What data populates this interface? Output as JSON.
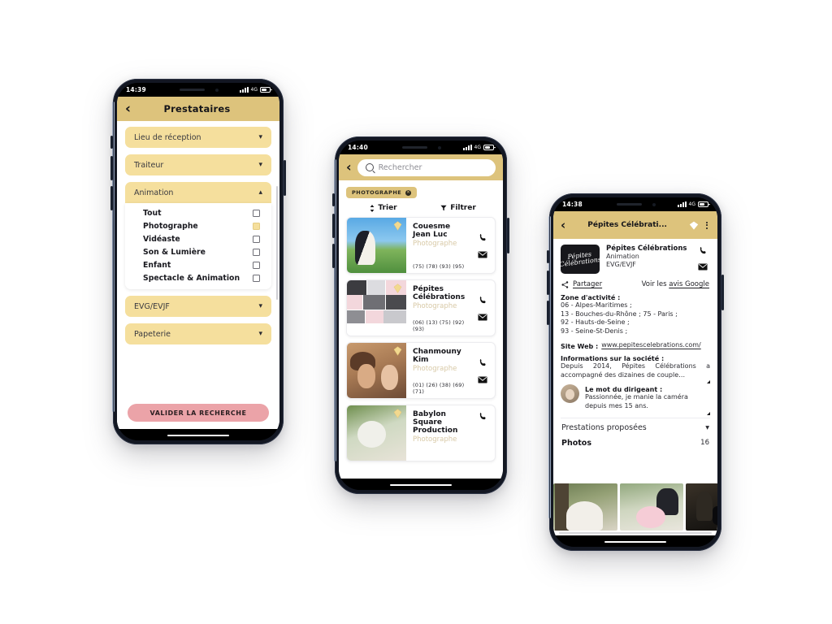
{
  "phone1": {
    "status": {
      "time": "14:39",
      "network": "4G"
    },
    "appbar": {
      "back_icon": "chevron-left-icon",
      "title": "Prestataires"
    },
    "accordions": [
      {
        "label": "Lieu de réception",
        "state": "collapsed",
        "chevron": "chevron-down-icon"
      },
      {
        "label": "Traiteur",
        "state": "collapsed",
        "chevron": "chevron-down-icon"
      },
      {
        "label": "Animation",
        "state": "expanded",
        "chevron": "chevron-up-icon"
      },
      {
        "label": "EVG/EVJF",
        "state": "collapsed",
        "chevron": "chevron-down-icon"
      },
      {
        "label": "Papeterie",
        "state": "collapsed",
        "chevron": "chevron-down-icon"
      }
    ],
    "animation_options": [
      {
        "label": "Tout",
        "checked": false
      },
      {
        "label": "Photographe",
        "checked": true
      },
      {
        "label": "Vidéaste",
        "checked": false
      },
      {
        "label": "Son & Lumière",
        "checked": false
      },
      {
        "label": "Enfant",
        "checked": false
      },
      {
        "label": "Spectacle & Animation",
        "checked": false
      }
    ],
    "cta": "VALIDER LA RECHERCHE"
  },
  "phone2": {
    "status": {
      "time": "14:40",
      "network": "4G"
    },
    "appbar": {
      "back_icon": "chevron-left-icon",
      "search_placeholder": "Rechercher",
      "search_value": ""
    },
    "chip": {
      "label": "PHOTOGRAPHE",
      "remove_icon": "close-circle-icon"
    },
    "controls": {
      "sort": "Trier",
      "filter": "Filtrer"
    },
    "results": [
      {
        "name": "Couesme Jean Luc",
        "category": "Photographe",
        "departments": "(75) (78) (93) (95)",
        "badge": "diamond-icon",
        "phone_icon": "phone-icon",
        "mail_icon": "mail-icon"
      },
      {
        "name": "Pépites Célébrations",
        "category": "Photographe",
        "departments": "(06) (13) (75) (92) (93)",
        "badge": "diamond-icon",
        "phone_icon": "phone-icon",
        "mail_icon": "mail-icon"
      },
      {
        "name": "Chanmouny Kim",
        "category": "Photographe",
        "departments": "(01) (26) (38) (69) (71)",
        "badge": "diamond-icon",
        "phone_icon": "phone-icon",
        "mail_icon": "mail-icon"
      },
      {
        "name": "Babylon Square Production",
        "category": "Photographe",
        "departments": "",
        "badge": "diamond-icon",
        "phone_icon": "phone-icon",
        "mail_icon": "mail-icon"
      }
    ]
  },
  "phone3": {
    "status": {
      "time": "14:38",
      "network": "4G"
    },
    "appbar": {
      "back_icon": "chevron-left-icon",
      "title": "Pépites Célébrati...",
      "gem_icon": "diamond-icon",
      "menu_icon": "more-vertical-icon"
    },
    "provider": {
      "name": "Pépites Célébrations",
      "category": "Animation",
      "subcategory": "EVG/EVJF",
      "logo_text": "Pépites Célébrations",
      "phone_icon": "phone-icon",
      "mail_icon": "mail-icon"
    },
    "actions": {
      "share": "Partager",
      "share_icon": "share-icon",
      "reviews_prefix": "Voir les ",
      "reviews_link": "avis Google"
    },
    "zone": {
      "heading": "Zone d'activité :",
      "lines": [
        "06 - Alpes-Maritimes ;",
        "13 - Bouches-du-Rhône ; 75 - Paris ;",
        "92 - Hauts-de-Seine ;",
        "93 - Seine-St-Denis ;"
      ]
    },
    "website": {
      "label": "Site Web :",
      "url": "www.pepitescelebrations.com/"
    },
    "company": {
      "heading": "Informations sur la société :",
      "text": "Depuis 2014, Pépites Célébrations a accompagné des dizaines de couple…"
    },
    "leader": {
      "heading": "Le mot du dirigeant :",
      "text": "Passionnée, je manie la caméra depuis mes 15 ans.",
      "avatar": "avatar"
    },
    "services_row": {
      "label": "Prestations proposées",
      "chevron": "chevron-down-icon"
    },
    "photos_row": {
      "label": "Photos",
      "count": "16"
    }
  },
  "colors": {
    "appbar": "#ddc37c",
    "accordion": "#f5df9d",
    "cta_pink": "#eba3a8",
    "chip": "#ddc37c",
    "category_text": "#d8c9a6",
    "page_bg": "#ffffff"
  }
}
